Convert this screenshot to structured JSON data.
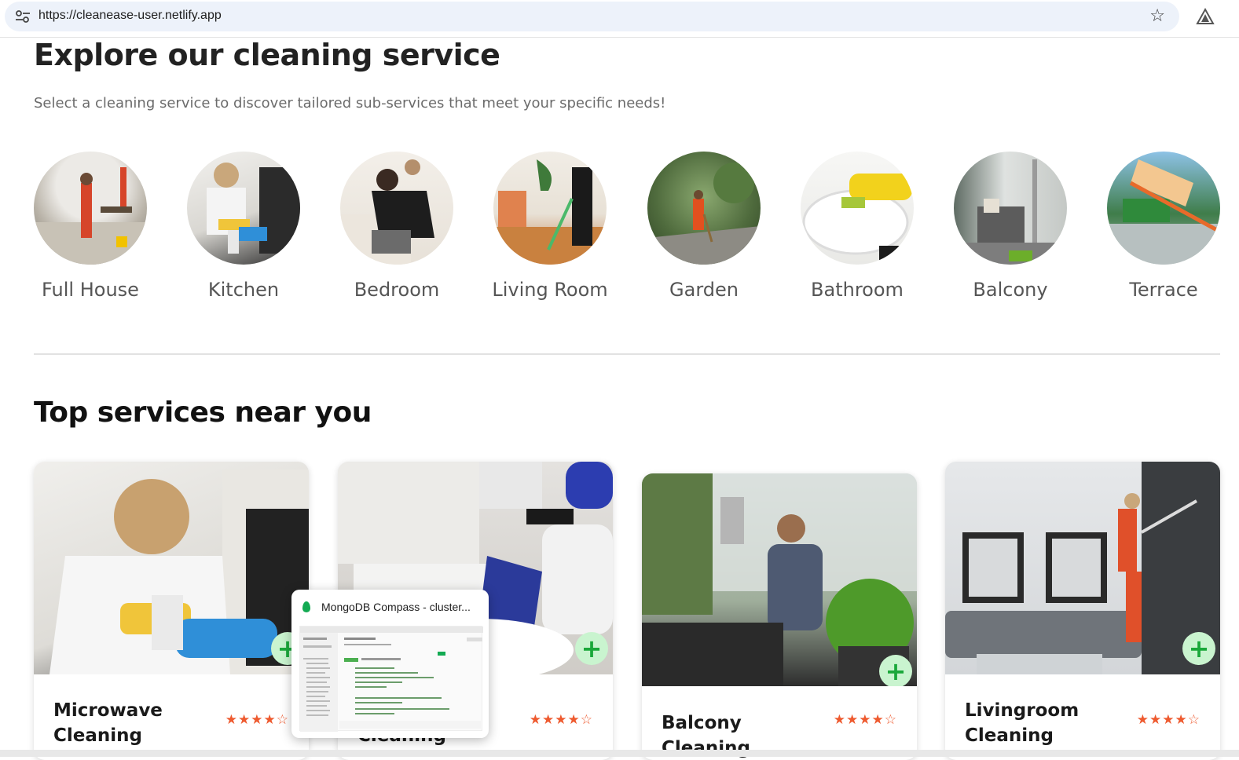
{
  "browser": {
    "url": "https://cleanease-user.netlify.app"
  },
  "explore": {
    "title": "Explore our cleaning service",
    "subtitle": "Select a cleaning service to discover tailored sub-services that meet your specific needs!",
    "categories": [
      {
        "label": "Full House"
      },
      {
        "label": "Kitchen"
      },
      {
        "label": "Bedroom"
      },
      {
        "label": "Living Room"
      },
      {
        "label": "Garden"
      },
      {
        "label": "Bathroom"
      },
      {
        "label": "Balcony"
      },
      {
        "label": "Terrace"
      }
    ]
  },
  "top_services": {
    "title": "Top services near you",
    "cards": [
      {
        "title": "Microwave Cleaning",
        "rating": 4,
        "stars": "★★★★☆"
      },
      {
        "title": "Cleaning",
        "rating": 4,
        "stars": "★★★★☆"
      },
      {
        "title": "Balcony Cleaning",
        "rating": 4,
        "stars": "★★★★☆"
      },
      {
        "title": "Livingroom Cleaning",
        "rating": 4,
        "stars": "★★★★☆"
      }
    ],
    "add_symbol": "+"
  },
  "taskbar_preview": {
    "title": "MongoDB Compass - cluster..."
  },
  "icons": {
    "site_info": "tune-icon",
    "bookmark": "star-outline-icon",
    "extension": "triangle-icon",
    "app": "mongodb-leaf-icon"
  },
  "colors": {
    "accent_green": "#1aa83a",
    "add_bg": "#c9f4cf",
    "star_orange": "#ee5a2f"
  }
}
